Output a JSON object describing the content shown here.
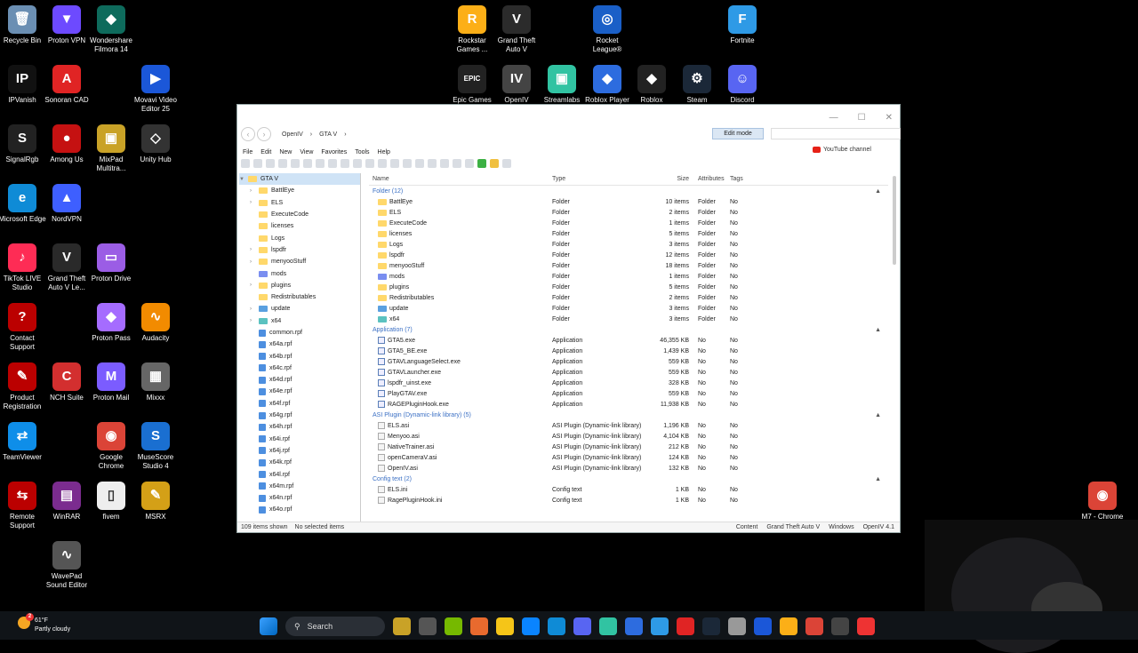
{
  "desktop_icons": [
    {
      "label": "Recycle Bin",
      "icon": "recycle-bin-icon",
      "color": "#6b8fb3",
      "glyph": "🗑"
    },
    {
      "label": "Proton VPN",
      "icon": "proton-vpn-icon",
      "color": "#6d4aff",
      "glyph": "▼"
    },
    {
      "label": "Wondershare Filmora 14",
      "icon": "filmora-icon",
      "color": "#0e6b5c",
      "glyph": "◆"
    },
    {
      "label": "IPVanish",
      "icon": "ipvanish-icon",
      "color": "#111",
      "glyph": "IP"
    },
    {
      "label": "Sonoran CAD",
      "icon": "sonoran-cad-icon",
      "color": "#e02424",
      "glyph": "A"
    },
    {
      "label": "Movavi Video Editor 25",
      "icon": "movavi-icon",
      "color": "#1b57d8",
      "glyph": "▶"
    },
    {
      "label": "SignalRgb",
      "icon": "signalrgb-icon",
      "color": "#222",
      "glyph": "S"
    },
    {
      "label": "Among Us",
      "icon": "among-us-icon",
      "color": "#c51111",
      "glyph": "●"
    },
    {
      "label": "MixPad Multitra...",
      "icon": "mixpad-icon",
      "color": "#c9a227",
      "glyph": "▣"
    },
    {
      "label": "Unity Hub",
      "icon": "unity-hub-icon",
      "color": "#333",
      "glyph": "◇"
    },
    {
      "label": "Microsoft Edge",
      "icon": "edge-icon",
      "color": "#0f8bd6",
      "glyph": "e"
    },
    {
      "label": "NordVPN",
      "icon": "nordvpn-icon",
      "color": "#3e5fff",
      "glyph": "▲"
    },
    {
      "label": "TikTok LIVE Studio",
      "icon": "tiktok-icon",
      "color": "#fe2c55",
      "glyph": "♪"
    },
    {
      "label": "Grand Theft Auto V Le...",
      "icon": "gta-icon",
      "color": "#2a2a2a",
      "glyph": "V"
    },
    {
      "label": "Proton Drive",
      "icon": "proton-drive-icon",
      "color": "#9b5de5",
      "glyph": "▭"
    },
    {
      "label": "Contact Support",
      "icon": "contact-support-icon",
      "color": "#b00",
      "glyph": "?"
    },
    {
      "label": "Proton Pass",
      "icon": "proton-pass-icon",
      "color": "#a56cff",
      "glyph": "◆"
    },
    {
      "label": "Audacity",
      "icon": "audacity-icon",
      "color": "#f28b00",
      "glyph": "∿"
    },
    {
      "label": "Product Registration",
      "icon": "product-registration-icon",
      "color": "#b00",
      "glyph": "✎"
    },
    {
      "label": "NCH Suite",
      "icon": "nch-suite-icon",
      "color": "#d32f2f",
      "glyph": "C"
    },
    {
      "label": "Proton Mail",
      "icon": "proton-mail-icon",
      "color": "#7b5cff",
      "glyph": "M"
    },
    {
      "label": "Mixxx",
      "icon": "mixxx-icon",
      "color": "#666",
      "glyph": "▦"
    },
    {
      "label": "TeamViewer",
      "icon": "teamviewer-icon",
      "color": "#0e8ee9",
      "glyph": "⇄"
    },
    {
      "label": "Google Chrome",
      "icon": "chrome-icon",
      "color": "#db4437",
      "glyph": "◉"
    },
    {
      "label": "MuseScore Studio 4",
      "icon": "musescore-icon",
      "color": "#1a6fd1",
      "glyph": "S"
    },
    {
      "label": "Remote Support",
      "icon": "remote-support-icon",
      "color": "#b00",
      "glyph": "⇆"
    },
    {
      "label": "WinRAR",
      "icon": "winrar-icon",
      "color": "#7b2c8f",
      "glyph": "▤"
    },
    {
      "label": "fivem",
      "icon": "fivem-file-icon",
      "color": "#eee",
      "glyph": "▯"
    },
    {
      "label": "MSRX",
      "icon": "msrx-icon",
      "color": "#d4a017",
      "glyph": "✎"
    },
    {
      "label": "WavePad Sound Editor",
      "icon": "wavepad-icon",
      "color": "#555",
      "glyph": "∿"
    },
    {
      "label": "Rockstar Games ...",
      "icon": "rockstar-icon",
      "color": "#fcaf17",
      "glyph": "R"
    },
    {
      "label": "Grand Theft Auto V",
      "icon": "gta5-icon",
      "color": "#2b2b2b",
      "glyph": "V"
    },
    {
      "label": "Rocket League®",
      "icon": "rocket-league-icon",
      "color": "#1a5fc7",
      "glyph": "◎"
    },
    {
      "label": "Fortnite",
      "icon": "fortnite-icon",
      "color": "#2e9ae6",
      "glyph": "F"
    },
    {
      "label": "Epic Games",
      "icon": "epic-games-icon",
      "color": "#222",
      "glyph": "EPIC"
    },
    {
      "label": "OpenIV",
      "icon": "openiv-icon",
      "color": "#444",
      "glyph": "IV"
    },
    {
      "label": "Streamlabs",
      "icon": "streamlabs-icon",
      "color": "#31c3a2",
      "glyph": "▣"
    },
    {
      "label": "Roblox Player",
      "icon": "roblox-player-icon",
      "color": "#2d6cdf",
      "glyph": "◆"
    },
    {
      "label": "Roblox",
      "icon": "roblox-icon",
      "color": "#222",
      "glyph": "◆"
    },
    {
      "label": "Steam",
      "icon": "steam-icon",
      "color": "#1b2838",
      "glyph": "⚙"
    },
    {
      "label": "Discord",
      "icon": "discord-icon",
      "color": "#5865f2",
      "glyph": "☺"
    },
    {
      "label": "M7 - Chrome",
      "icon": "m7-chrome-icon",
      "color": "#db4437",
      "glyph": "◉"
    }
  ],
  "window": {
    "breadcrumb": [
      "OpenIV",
      "GTA V"
    ],
    "edit_mode": "Edit mode",
    "menu": [
      "File",
      "Edit",
      "New",
      "View",
      "Favorites",
      "Tools",
      "Help"
    ],
    "youtube": "YouTube channel",
    "tree_root": "GTA V",
    "tree_folders": [
      "BattlEye",
      "ELS",
      "ExecuteCode",
      "licenses",
      "Logs",
      "lspdfr",
      "menyooStuff",
      "mods",
      "plugins",
      "Redistributables",
      "update",
      "x64"
    ],
    "tree_rpfs": [
      "common.rpf",
      "x64a.rpf",
      "x64b.rpf",
      "x64c.rpf",
      "x64d.rpf",
      "x64e.rpf",
      "x64f.rpf",
      "x64g.rpf",
      "x64h.rpf",
      "x64i.rpf",
      "x64j.rpf",
      "x64k.rpf",
      "x64l.rpf",
      "x64m.rpf",
      "x64n.rpf",
      "x64o.rpf"
    ],
    "columns": {
      "name": "Name",
      "type": "Type",
      "size": "Size",
      "attributes": "Attributes",
      "tags": "Tags"
    },
    "groups": [
      {
        "title": "Folder (12)",
        "kind": "folder",
        "rows": [
          [
            "BattlEye",
            "Folder",
            "10 items",
            "Folder",
            "No"
          ],
          [
            "ELS",
            "Folder",
            "2 items",
            "Folder",
            "No"
          ],
          [
            "ExecuteCode",
            "Folder",
            "1 items",
            "Folder",
            "No"
          ],
          [
            "licenses",
            "Folder",
            "5 items",
            "Folder",
            "No"
          ],
          [
            "Logs",
            "Folder",
            "3 items",
            "Folder",
            "No"
          ],
          [
            "lspdfr",
            "Folder",
            "12 items",
            "Folder",
            "No"
          ],
          [
            "menyooStuff",
            "Folder",
            "18 items",
            "Folder",
            "No"
          ],
          [
            "mods",
            "Folder",
            "1 items",
            "Folder",
            "No"
          ],
          [
            "plugins",
            "Folder",
            "5 items",
            "Folder",
            "No"
          ],
          [
            "Redistributables",
            "Folder",
            "2 items",
            "Folder",
            "No"
          ],
          [
            "update",
            "Folder",
            "3 items",
            "Folder",
            "No"
          ],
          [
            "x64",
            "Folder",
            "3 items",
            "Folder",
            "No"
          ]
        ]
      },
      {
        "title": "Application (7)",
        "kind": "exe",
        "rows": [
          [
            "GTA5.exe",
            "Application",
            "46,355 KB",
            "No",
            "No"
          ],
          [
            "GTA5_BE.exe",
            "Application",
            "1,439 KB",
            "No",
            "No"
          ],
          [
            "GTAVLanguageSelect.exe",
            "Application",
            "559 KB",
            "No",
            "No"
          ],
          [
            "GTAVLauncher.exe",
            "Application",
            "559 KB",
            "No",
            "No"
          ],
          [
            "lspdfr_uinst.exe",
            "Application",
            "328 KB",
            "No",
            "No"
          ],
          [
            "PlayGTAV.exe",
            "Application",
            "559 KB",
            "No",
            "No"
          ],
          [
            "RAGEPluginHook.exe",
            "Application",
            "11,938 KB",
            "No",
            "No"
          ]
        ]
      },
      {
        "title": "ASI Plugin (Dynamic-link library) (5)",
        "kind": "asi",
        "rows": [
          [
            "ELS.asi",
            "ASI Plugin (Dynamic-link library)",
            "1,196 KB",
            "No",
            "No"
          ],
          [
            "Menyoo.asi",
            "ASI Plugin (Dynamic-link library)",
            "4,104 KB",
            "No",
            "No"
          ],
          [
            "NativeTrainer.asi",
            "ASI Plugin (Dynamic-link library)",
            "212 KB",
            "No",
            "No"
          ],
          [
            "openCameraV.asi",
            "ASI Plugin (Dynamic-link library)",
            "124 KB",
            "No",
            "No"
          ],
          [
            "OpenIV.asi",
            "ASI Plugin (Dynamic-link library)",
            "132 KB",
            "No",
            "No"
          ]
        ]
      },
      {
        "title": "Config text (2)",
        "kind": "cfg",
        "rows": [
          [
            "ELS.ini",
            "Config text",
            "1 KB",
            "No",
            "No"
          ],
          [
            "RagePluginHook.ini",
            "Config text",
            "1 KB",
            "No",
            "No"
          ]
        ]
      }
    ],
    "status": {
      "items": "109 items shown",
      "selected": "No selected items",
      "content": "Content",
      "game": "Grand Theft Auto V",
      "platform": "Windows",
      "version": "OpenIV 4.1"
    }
  },
  "taskbar": {
    "temp": "61°F",
    "weather": "Partly cloudy",
    "search": "Search",
    "badge": "2"
  }
}
